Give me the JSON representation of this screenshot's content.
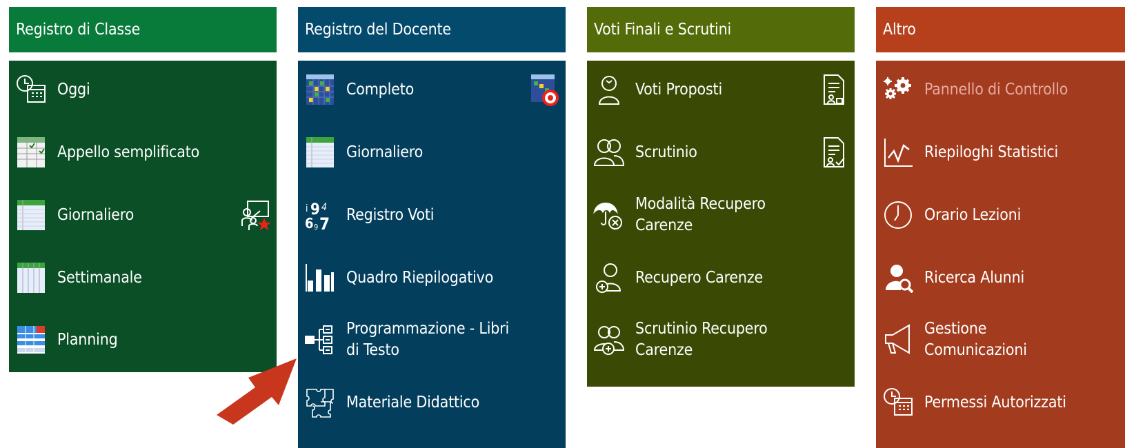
{
  "colors": {
    "classe_header": "#087a3a",
    "classe_panel": "#0a4f25",
    "docente_header": "#034a6c",
    "docente_panel": "#033f5d",
    "voti_header": "#536b08",
    "voti_panel": "#3a4a05",
    "altro_header": "#b63f1c",
    "altro_panel": "#a33b1e",
    "arrow": "#c8361e"
  },
  "columns": {
    "classe": {
      "title": "Registro di Classe",
      "items": [
        {
          "label": "Oggi",
          "icon": "calendar-clock-icon"
        },
        {
          "label": "Appello semplificato",
          "icon": "attendance-sheet-icon"
        },
        {
          "label": "Giornaliero",
          "icon": "daily-register-icon",
          "right_icon": "teacher-star-icon"
        },
        {
          "label": "Settimanale",
          "icon": "weekly-register-icon"
        },
        {
          "label": "Planning",
          "icon": "planning-grid-icon"
        }
      ]
    },
    "docente": {
      "title": "Registro del Docente",
      "items": [
        {
          "label": "Completo",
          "icon": "full-register-icon",
          "right_icon": "register-target-icon"
        },
        {
          "label": "Giornaliero",
          "icon": "daily-register-icon"
        },
        {
          "label": "Registro Voti",
          "icon": "grades-numbers-icon"
        },
        {
          "label": "Quadro Riepilogativo",
          "icon": "bar-chart-icon"
        },
        {
          "label": "Programmazione - Libri di Testo",
          "icon": "tree-structure-icon"
        },
        {
          "label": "Materiale Didattico",
          "icon": "puzzle-icon"
        }
      ]
    },
    "voti": {
      "title": "Voti Finali e Scrutini",
      "items": [
        {
          "label": "Voti Proposti",
          "icon": "student-icon",
          "right_icon": "document-person-icon"
        },
        {
          "label": "Scrutinio",
          "icon": "students-group-icon",
          "right_icon": "document-check-icon"
        },
        {
          "label": "Modalità Recupero Carenze",
          "icon": "umbrella-cancel-icon"
        },
        {
          "label": "Recupero Carenze",
          "icon": "student-plus-icon"
        },
        {
          "label": "Scrutinio Recupero Carenze",
          "icon": "group-plus-icon"
        }
      ]
    },
    "altro": {
      "title": "Altro",
      "items": [
        {
          "label": "Pannello di Controllo",
          "icon": "gears-icon",
          "disabled": true
        },
        {
          "label": "Riepiloghi Statistici",
          "icon": "line-chart-icon"
        },
        {
          "label": "Orario Lezioni",
          "icon": "clock-icon"
        },
        {
          "label": "Ricerca Alunni",
          "icon": "user-search-icon"
        },
        {
          "label": "Gestione Comunicazioni",
          "icon": "megaphone-icon"
        },
        {
          "label": "Permessi Autorizzati",
          "icon": "calendar-clock-icon"
        }
      ]
    }
  }
}
